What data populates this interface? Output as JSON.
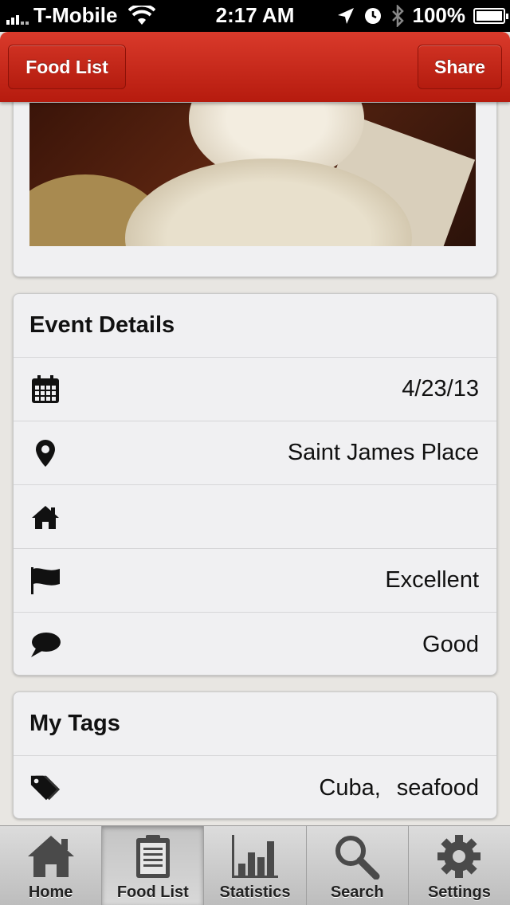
{
  "status_bar": {
    "carrier": "T-Mobile",
    "time": "2:17 AM",
    "battery": "100%"
  },
  "header": {
    "back_label": "Food List",
    "share_label": "Share"
  },
  "event_details": {
    "title": "Event Details",
    "rows": [
      {
        "icon": "calendar-icon",
        "value": "4/23/13"
      },
      {
        "icon": "location-pin-icon",
        "value": "Saint James Place"
      },
      {
        "icon": "home-icon",
        "value": ""
      },
      {
        "icon": "flag-icon",
        "value": "Excellent"
      },
      {
        "icon": "speech-bubble-icon",
        "value": "Good"
      }
    ]
  },
  "my_tags": {
    "title": "My Tags",
    "tags": [
      "Cuba,",
      "seafood"
    ]
  },
  "tabbar": {
    "tabs": [
      {
        "label": "Home",
        "icon": "home-icon",
        "active": false
      },
      {
        "label": "Food List",
        "icon": "clipboard-icon",
        "active": true
      },
      {
        "label": "Statistics",
        "icon": "bar-chart-icon",
        "active": false
      },
      {
        "label": "Search",
        "icon": "search-icon",
        "active": false
      },
      {
        "label": "Settings",
        "icon": "gear-icon",
        "active": false
      }
    ]
  },
  "colors": {
    "header_red": "#c4281a",
    "card_bg": "#f0f0f2",
    "page_bg": "#e8e6e2"
  }
}
